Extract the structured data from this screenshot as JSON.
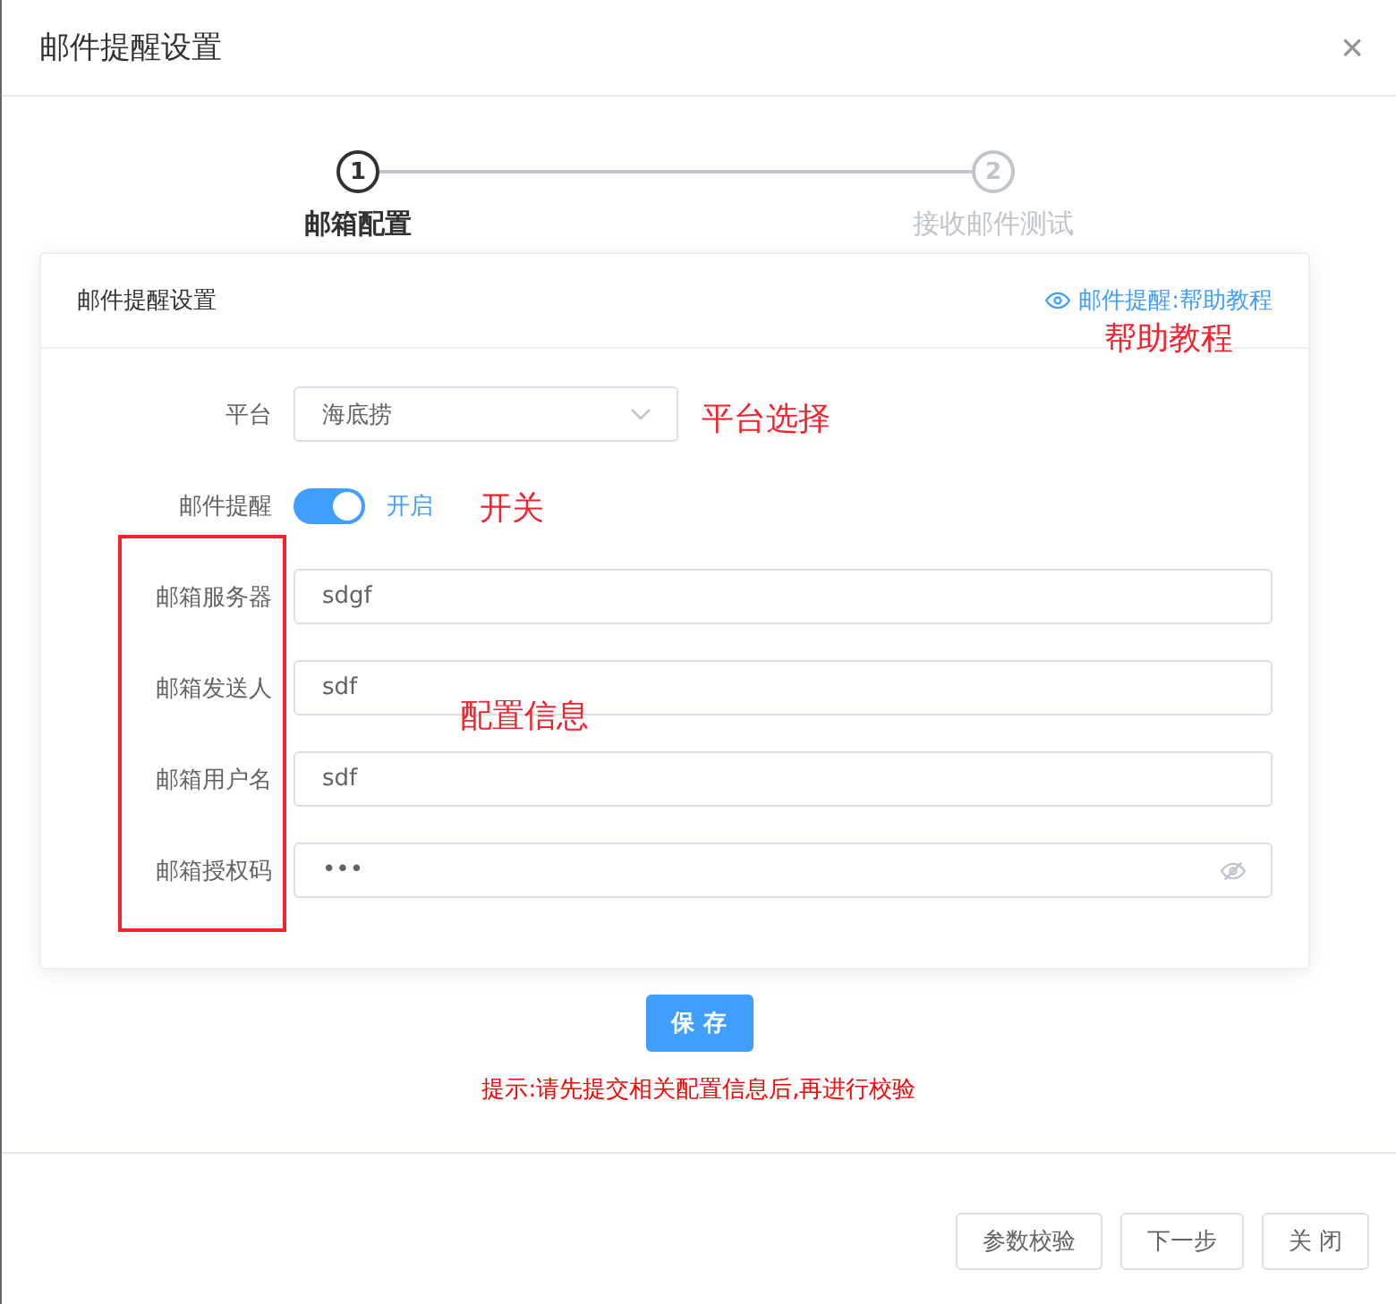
{
  "dialog": {
    "title": "邮件提醒设置",
    "close": "×"
  },
  "steps": [
    {
      "number": "1",
      "label": "邮箱配置",
      "selected": true
    },
    {
      "number": "2",
      "label": "接收邮件测试",
      "selected": false
    }
  ],
  "card": {
    "title": "邮件提醒设置",
    "help_link": "邮件提醒:帮助教程"
  },
  "form": [
    {
      "kind": "select",
      "label": "平台",
      "value": "海底捞"
    },
    {
      "kind": "switch",
      "label": "邮件提醒",
      "on": true,
      "state_text": "开启"
    },
    {
      "kind": "text",
      "label": "邮箱服务器",
      "value": "sdgf"
    },
    {
      "kind": "text",
      "label": "邮箱发送人",
      "value": "sdf"
    },
    {
      "kind": "text",
      "label": "邮箱用户名",
      "value": "sdf"
    },
    {
      "kind": "password",
      "label": "邮箱授权码",
      "value": "•••"
    }
  ],
  "save_button": "保 存",
  "hint": "提示:请先提交相关配置信息后,再进行校验",
  "footer_buttons": [
    "参数校验",
    "下一步",
    "关 闭"
  ],
  "annotations": [
    {
      "kind": "text",
      "text": "帮助教程"
    },
    {
      "kind": "text",
      "text": "平台选择"
    },
    {
      "kind": "text",
      "text": "开关"
    },
    {
      "kind": "box"
    },
    {
      "kind": "text",
      "text": "配置信息"
    }
  ]
}
